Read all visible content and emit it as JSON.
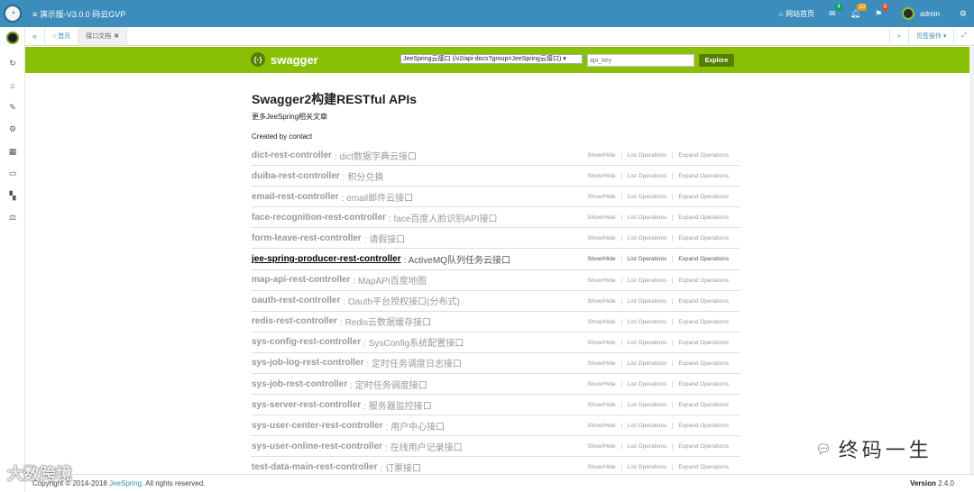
{
  "app": {
    "title": "≡ 演示版-V3.0.0 码云GVP",
    "logo_icon": "eye-icon"
  },
  "topbar": {
    "site_home": "网站首页",
    "mail_count": "4",
    "notify_count": "10",
    "flag_count": "9",
    "user": "admin"
  },
  "sidebar": {
    "icons": [
      "refresh-icon",
      "home-icon",
      "edit-icon",
      "gear-icon",
      "grid-icon",
      "monitor-icon",
      "map-icon",
      "balance-icon"
    ]
  },
  "tabbar": {
    "tabs": [
      {
        "label": "首页"
      },
      {
        "label": "接口文档",
        "close": "✖"
      }
    ],
    "page_ops": "页签操作"
  },
  "swagger": {
    "logo_text": "swagger",
    "group_select": "JeeSpring云接口 (/v2/api-docs?group=JeeSpring云接口)",
    "api_key_placeholder": "api_key",
    "explore_label": "Explore"
  },
  "api": {
    "title": "Swagger2构建RESTful APIs",
    "description": "更多JeeSpring相关文章",
    "created_by": "Created by contact"
  },
  "ops_labels": {
    "show_hide": "Show/Hide",
    "list": "List Operations",
    "expand": "Expand Operations"
  },
  "resources": [
    {
      "name": "dict-rest-controller",
      "desc": ": dict数据字典云接口"
    },
    {
      "name": "duiba-rest-controller",
      "desc": ": 积分兑换"
    },
    {
      "name": "email-rest-controller",
      "desc": ": email邮件云接口"
    },
    {
      "name": "face-recognition-rest-controller",
      "desc": ": face百度人脸识别API接口"
    },
    {
      "name": "form-leave-rest-controller",
      "desc": ": 请假接口"
    },
    {
      "name": "jee-spring-producer-rest-controller",
      "desc": ": ActiveMQ队列任务云接口",
      "highlight": true
    },
    {
      "name": "map-api-rest-controller",
      "desc": ": MapAPI百度地图"
    },
    {
      "name": "oauth-rest-controller",
      "desc": ": Oauth平台授权接口(分布式)"
    },
    {
      "name": "redis-rest-controller",
      "desc": ": Redis云数据缓存接口"
    },
    {
      "name": "sys-config-rest-controller",
      "desc": ": SysConfig系统配置接口"
    },
    {
      "name": "sys-job-log-rest-controller",
      "desc": ": 定时任务调度日志接口"
    },
    {
      "name": "sys-job-rest-controller",
      "desc": ": 定时任务调度接口"
    },
    {
      "name": "sys-server-rest-controller",
      "desc": ": 服务器监控接口"
    },
    {
      "name": "sys-user-center-rest-controller",
      "desc": ": 用户中心接口"
    },
    {
      "name": "sys-user-online-rest-controller",
      "desc": ": 在线用户记录接口"
    },
    {
      "name": "test-data-main-rest-controller",
      "desc": ": 订票接口"
    }
  ],
  "footer": {
    "copyright_prefix": "Copyright © 2014-2018",
    "copyright_link": "JeeSpring",
    "copyright_suffix": ". All rights reserved.",
    "version_label": "Version",
    "version": "2.4.0"
  },
  "watermarks": {
    "left": "大数跨境",
    "right": "终码一生"
  },
  "colors": {
    "topbar": "#3c8dbc",
    "swagger_green": "#89bf04",
    "swagger_dark": "#547f00"
  }
}
